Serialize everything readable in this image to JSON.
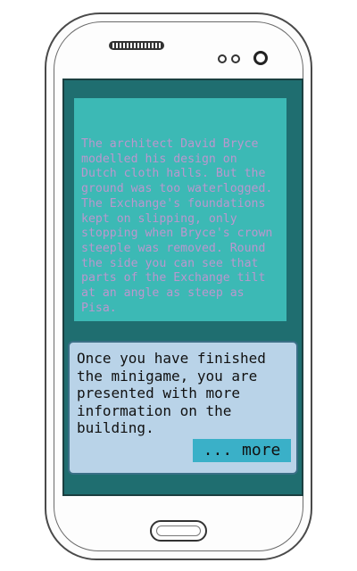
{
  "info_panel": {
    "text": "The architect David Bryce modelled his design on Dutch cloth halls. But the ground was too waterlogged. The Exchange's foundations kept on slipping, only stopping when Bryce's crown steeple was removed. Round the side you can see that parts of the Exchange tilt at an angle as steep as Pisa."
  },
  "dialog": {
    "text": "Once you have finished\nthe minigame, you are\npresented with more\ninformation on the\nbuilding.",
    "more_label": "... more"
  },
  "colors": {
    "screen_bg": "#1f6e70",
    "info_panel_bg": "#3cb9b5",
    "info_text": "#bc97ce",
    "dialog_bg": "#b9d3e8",
    "more_button_bg": "#3ab0c8"
  },
  "icons": {
    "speaker": "speaker-grille-icon",
    "sensor_left": "sensor-icon",
    "sensor_right": "sensor-icon",
    "camera": "front-camera-icon",
    "home": "home-button-icon"
  }
}
